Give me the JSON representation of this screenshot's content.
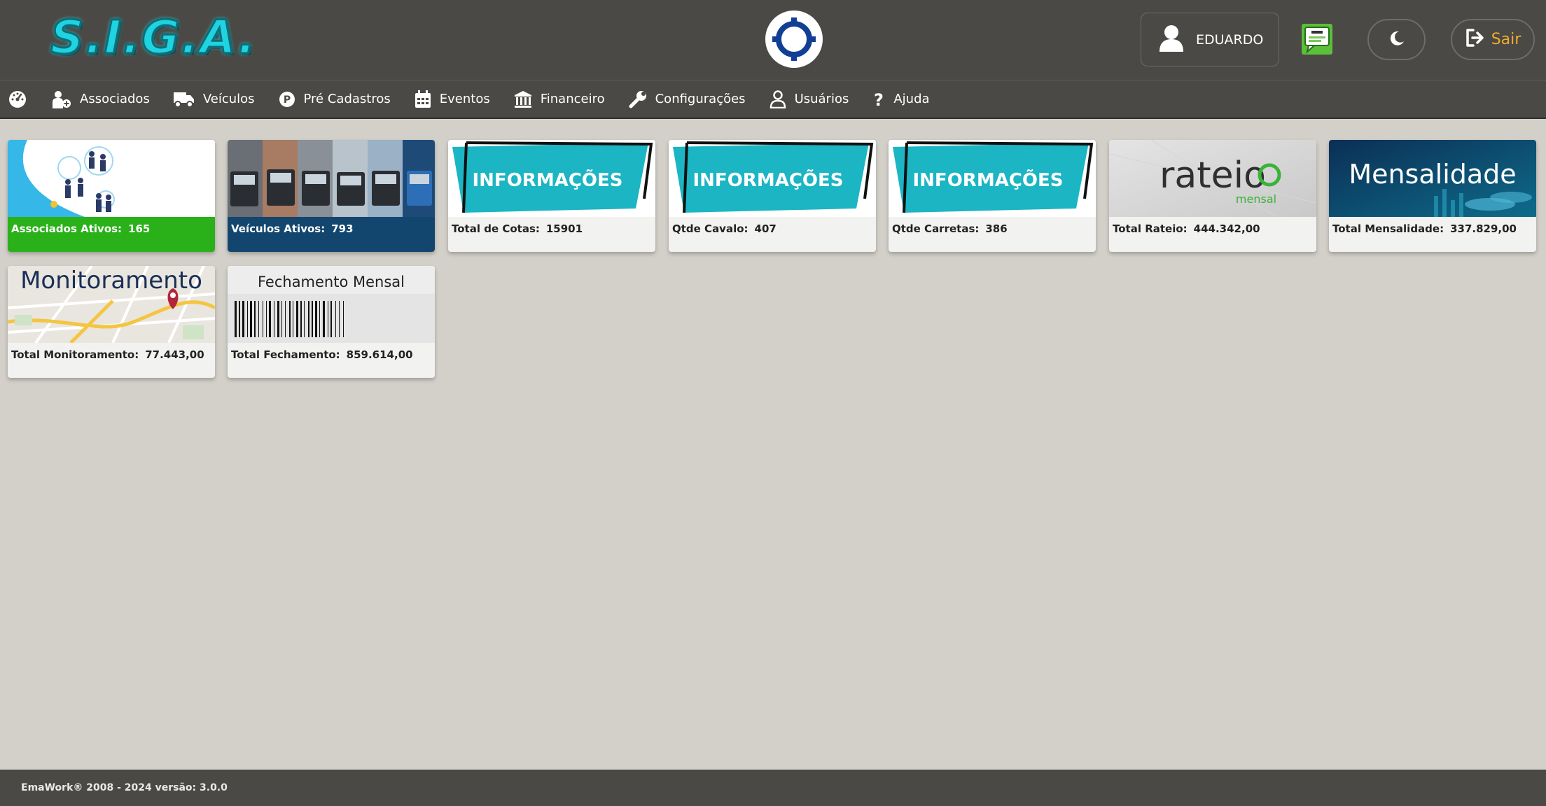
{
  "header": {
    "logo_text": "S.I.G.A.",
    "user_name": "EDUARDO",
    "logout_label": "Sair"
  },
  "nav": {
    "items": [
      {
        "label": "Associados",
        "icon": "user-plus-icon"
      },
      {
        "label": "Veículos",
        "icon": "truck-icon"
      },
      {
        "label": "Pré Cadastros",
        "icon": "parking-p-icon"
      },
      {
        "label": "Eventos",
        "icon": "calendar-icon"
      },
      {
        "label": "Financeiro",
        "icon": "bank-icon"
      },
      {
        "label": "Configurações",
        "icon": "wrench-icon"
      },
      {
        "label": "Usuários",
        "icon": "user-icon"
      },
      {
        "label": "Ajuda",
        "icon": "question-icon"
      }
    ]
  },
  "cards": [
    {
      "label": "Associados Ativos:",
      "value": "165",
      "image_text": "",
      "bg": "#2ab11a"
    },
    {
      "label": "Veículos Ativos:",
      "value": "793",
      "image_text": "",
      "bg": "#13466e"
    },
    {
      "label": "Total de Cotas:",
      "value": "15901",
      "image_text": "INFORMAÇÕES"
    },
    {
      "label": "Qtde Cavalo:",
      "value": "407",
      "image_text": "INFORMAÇÕES"
    },
    {
      "label": "Qtde Carretas:",
      "value": "386",
      "image_text": "INFORMAÇÕES"
    },
    {
      "label": "Total Rateio:",
      "value": "444.342,00",
      "image_text": "rateio",
      "image_subtext": "mensal"
    },
    {
      "label": "Total Mensalidade:",
      "value": "337.829,00",
      "image_text": "Mensalidade"
    },
    {
      "label": "Total Monitoramento:",
      "value": "77.443,00",
      "image_text": "Monitoramento"
    },
    {
      "label": "Total Fechamento:",
      "value": "859.614,00",
      "image_text": "Fechamento Mensal"
    }
  ],
  "footer": {
    "text": "EmaWork® 2008 - 2024 versão: 3.0.0"
  },
  "colors": {
    "header_bg": "#4a4945",
    "page_bg": "#d3d0c9",
    "accent_teal": "#1bb5c3",
    "logout": "#f0ad2e"
  }
}
